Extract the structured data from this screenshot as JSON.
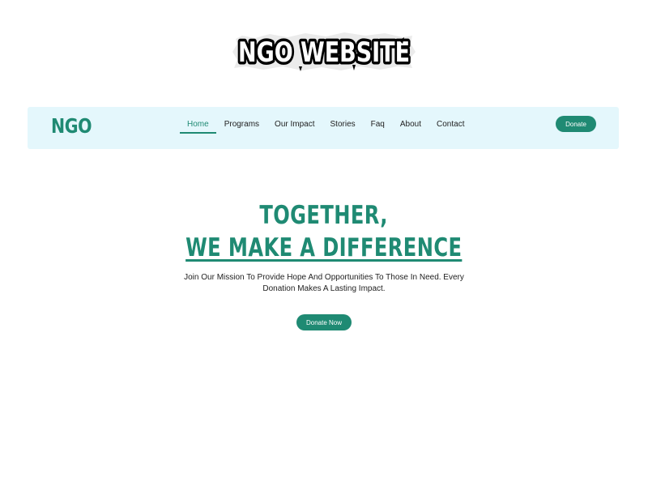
{
  "banner": {
    "title": "NGO WEBSITE"
  },
  "navbar": {
    "brand": "NGO",
    "links": [
      {
        "label": "Home",
        "active": true
      },
      {
        "label": "Programs",
        "active": false
      },
      {
        "label": "Our Impact",
        "active": false
      },
      {
        "label": "Stories",
        "active": false
      },
      {
        "label": "Faq",
        "active": false
      },
      {
        "label": "About",
        "active": false
      },
      {
        "label": "Contact",
        "active": false
      }
    ],
    "donate_label": "Donate"
  },
  "hero": {
    "line1": "TOGETHER,",
    "line2": "WE MAKE A DIFFERENCE",
    "subtitle": "Join Our Mission To Provide Hope And Opportunities To Those In Need. Every Donation Makes A Lasting Impact.",
    "cta_label": "Donate Now"
  },
  "colors": {
    "accent": "#1f8a73",
    "navbar_bg": "#e4f7fc",
    "text": "#222222",
    "background": "#ffffff"
  }
}
